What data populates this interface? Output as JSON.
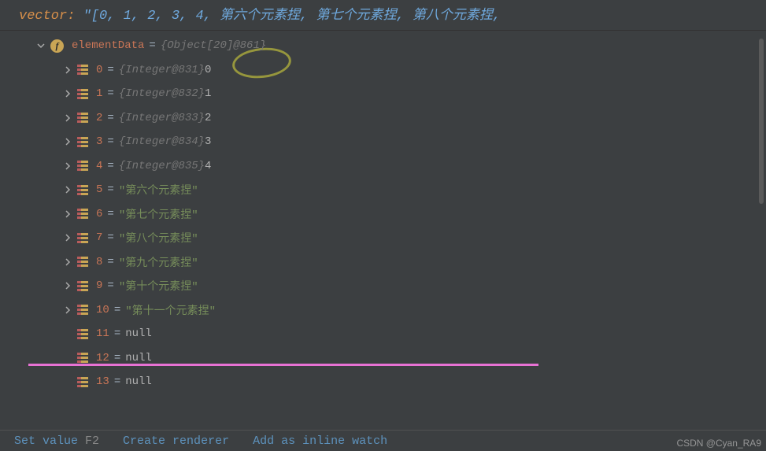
{
  "header": {
    "label": "vector: ",
    "value": "\"[0, 1, 2, 3, 4, 第六个元素捏, 第七个元素捏, 第八个元素捏,"
  },
  "root": {
    "name": "elementData",
    "type": "{Object[20]@861}"
  },
  "elements": [
    {
      "idx": "0",
      "type": "{Integer@831}",
      "val": "0",
      "kind": "int",
      "expandable": true
    },
    {
      "idx": "1",
      "type": "{Integer@832}",
      "val": "1",
      "kind": "int",
      "expandable": true
    },
    {
      "idx": "2",
      "type": "{Integer@833}",
      "val": "2",
      "kind": "int",
      "expandable": true
    },
    {
      "idx": "3",
      "type": "{Integer@834}",
      "val": "3",
      "kind": "int",
      "expandable": true
    },
    {
      "idx": "4",
      "type": "{Integer@835}",
      "val": "4",
      "kind": "int",
      "expandable": true
    },
    {
      "idx": "5",
      "type": "",
      "val": "\"第六个元素捏\"",
      "kind": "str",
      "expandable": true
    },
    {
      "idx": "6",
      "type": "",
      "val": "\"第七个元素捏\"",
      "kind": "str",
      "expandable": true
    },
    {
      "idx": "7",
      "type": "",
      "val": "\"第八个元素捏\"",
      "kind": "str",
      "expandable": true
    },
    {
      "idx": "8",
      "type": "",
      "val": "\"第九个元素捏\"",
      "kind": "str",
      "expandable": true
    },
    {
      "idx": "9",
      "type": "",
      "val": "\"第十个元素捏\"",
      "kind": "str",
      "expandable": true
    },
    {
      "idx": "10",
      "type": "",
      "val": "\"第十一个元素捏\"",
      "kind": "str",
      "expandable": true
    },
    {
      "idx": "11",
      "type": "",
      "val": "null",
      "kind": "null",
      "expandable": false
    },
    {
      "idx": "12",
      "type": "",
      "val": "null",
      "kind": "null",
      "expandable": false
    },
    {
      "idx": "13",
      "type": "",
      "val": "null",
      "kind": "null",
      "expandable": false
    }
  ],
  "footer": {
    "setValue": "Set value",
    "setValueKey": "F2",
    "createRenderer": "Create renderer",
    "addInlineWatch": "Add as inline watch"
  },
  "watermark": "CSDN @Cyan_RA9",
  "icons": {
    "field": "f"
  }
}
